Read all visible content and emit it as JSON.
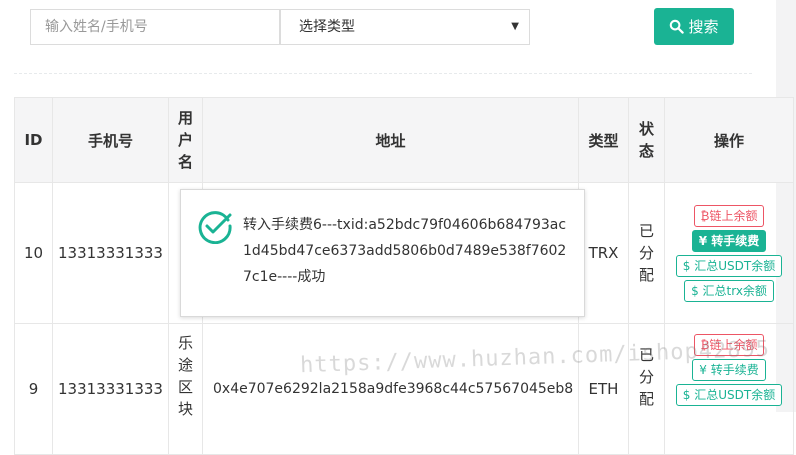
{
  "search": {
    "placeholder": "输入姓名/手机号",
    "select_value": "选择类型",
    "button_label": "搜索"
  },
  "table": {
    "headers": {
      "id": "ID",
      "phone": "手机号",
      "username": "用户名",
      "address": "地址",
      "type": "类型",
      "status": "状态",
      "actions": "操作"
    },
    "rows": [
      {
        "id": "10",
        "phone": "13313331333",
        "username": "",
        "address": "",
        "type": "TRX",
        "status": "已分配",
        "actions": [
          "链上余额",
          "转手续费",
          "汇总USDT余额",
          "汇总trx余额"
        ]
      },
      {
        "id": "9",
        "phone": "13313331333",
        "username": "乐途区块",
        "address": "0x4e707e6292la2158a9dfe3968c44c57567045eb8",
        "type": "ETH",
        "status": "已分配",
        "actions": [
          "链上余额",
          "转手续费",
          "汇总USDT余额"
        ]
      }
    ]
  },
  "toast": {
    "message": "转入手续费6---txid:a52bdc79f04606b684793ac1d45bd47ce6373add5806b0d7489e538f76027c1e----成功"
  },
  "watermark": "https://www.huzhan.com/ishop42895",
  "colors": {
    "primary": "#1ab394",
    "danger": "#ed5565",
    "header_bg": "#f5f5f6"
  }
}
